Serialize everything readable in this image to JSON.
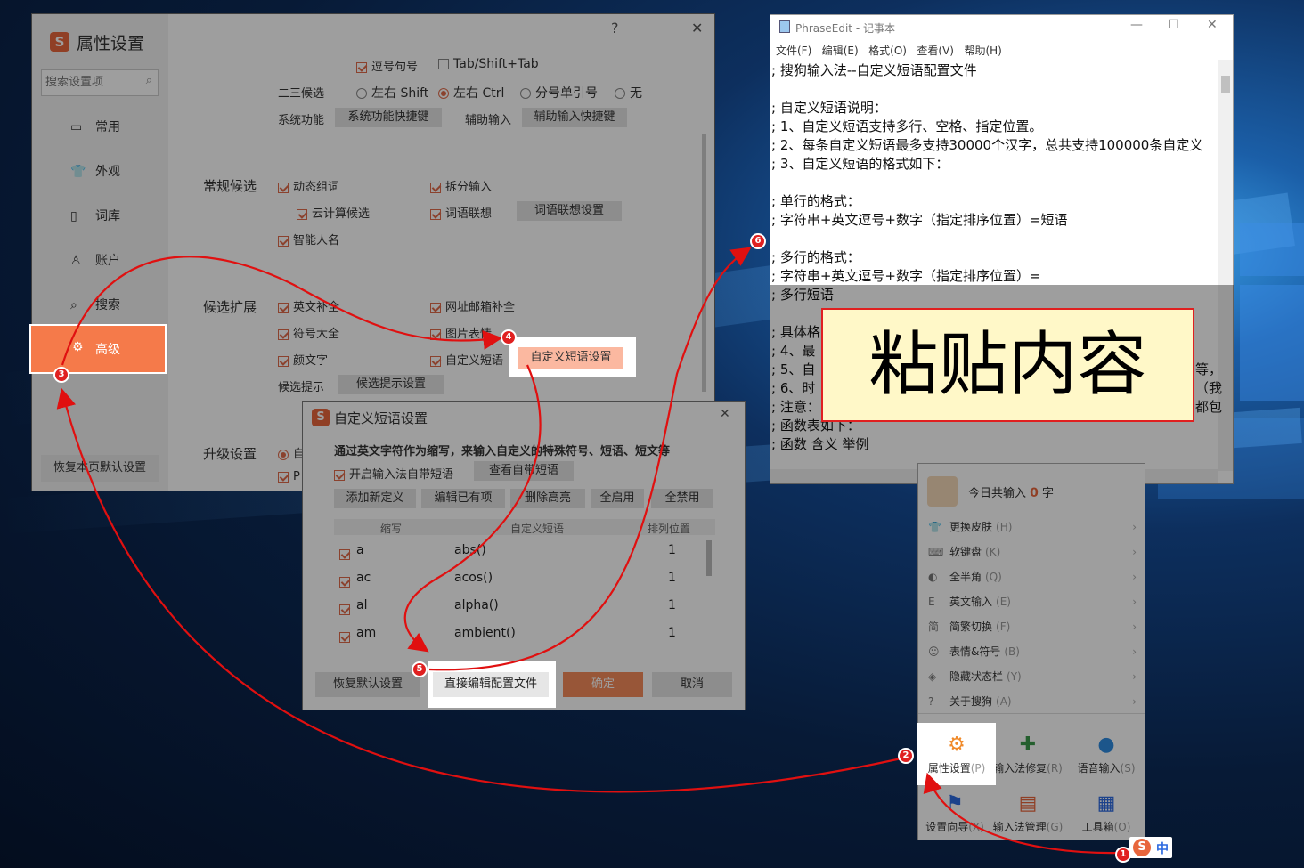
{
  "settings_window": {
    "title": "属性设置",
    "help_label": "?",
    "close_label": "✕",
    "search_placeholder": "搜索设置项",
    "nav": [
      {
        "label": "常用",
        "icon": "monitor-icon"
      },
      {
        "label": "外观",
        "icon": "shirt-icon"
      },
      {
        "label": "词库",
        "icon": "book-icon"
      },
      {
        "label": "账户",
        "icon": "person-icon"
      },
      {
        "label": "搜索",
        "icon": "search-icon"
      },
      {
        "label": "高级",
        "icon": "gear-icon"
      }
    ],
    "restore_default": "恢复本页默认设置",
    "row_top": {
      "comma_period": "逗号句号",
      "tab_shift": "Tab/Shift+Tab"
    },
    "second_third": {
      "label": "二三候选",
      "options": [
        "左右 Shift",
        "左右 Ctrl",
        "分号单引号",
        "无"
      ]
    },
    "system_func": {
      "label": "系统功能",
      "button": "系统功能快捷键",
      "aux_label": "辅助输入",
      "aux_button": "辅助输入快捷键"
    },
    "regular": {
      "label": "常规候选",
      "items": [
        "动态组词",
        "拆分输入",
        "云计算候选",
        "词语联想",
        "智能人名"
      ],
      "assoc_button": "词语联想设置"
    },
    "ext": {
      "label": "候选扩展",
      "items": [
        "英文补全",
        "网址邮箱补全",
        "符号大全",
        "图片表情",
        "颜文字",
        "自定义短语"
      ],
      "phrase_button": "自定义短语设置",
      "hint_label": "候选提示",
      "hint_button": "候选提示设置"
    },
    "upgrade": {
      "label": "升级设置",
      "opt1": "自",
      "opt2": "P"
    }
  },
  "phrase_dialog": {
    "title": "自定义短语设置",
    "close_label": "✕",
    "description": "通过英文字符作为缩写，来输入自定义的特殊符号、短语、短文等",
    "enable_label": "开启输入法自带短语",
    "view_button": "查看自带短语",
    "buttons": [
      "添加新定义",
      "编辑已有项",
      "删除高亮",
      "全启用",
      "全禁用"
    ],
    "columns": [
      "缩写",
      "自定义短语",
      "排列位置"
    ],
    "rows": [
      {
        "abbr": "a",
        "phrase": "abs()",
        "pos": "1"
      },
      {
        "abbr": "ac",
        "phrase": "acos()",
        "pos": "1"
      },
      {
        "abbr": "al",
        "phrase": "alpha()",
        "pos": "1"
      },
      {
        "abbr": "am",
        "phrase": "ambient()",
        "pos": "1"
      }
    ],
    "restore_button": "恢复默认设置",
    "edit_file_button": "直接编辑配置文件",
    "ok_button": "确定",
    "cancel_button": "取消"
  },
  "notepad": {
    "title": "PhraseEdit - 记事本",
    "menu": [
      "文件(F)",
      "编辑(E)",
      "格式(O)",
      "查看(V)",
      "帮助(H)"
    ],
    "lines": [
      ";  搜狗输入法--自定义短语配置文件",
      "",
      ";  自定义短语说明：",
      ";  1、自定义短语支持多行、空格、指定位置。",
      ";  2、每条自定义短语最多支持30000个汉字，总共支持100000条自定义",
      ";  3、自定义短语的格式如下：",
      "",
      ";  单行的格式：",
      ";  字符串+英文逗号+数字（指定排序位置）=短语",
      "",
      ";  多行的格式：",
      ";  字符串+英文逗号+数字（指定排序位置）=",
      ";  多行短语",
      "",
      ";  具体格",
      ";  4、最",
      ";  5、自",
      ";  6、时",
      ";  注意：",
      ";  函数表如下：",
      ";  函数         含义           举例"
    ],
    "right_clip": [
      "",
      "",
      "",
      "",
      "",
      "",
      "",
      "",
      "",
      "",
      "",
      "",
      "",
      "",
      "",
      "",
      "等，",
      "（我",
      "都包",
      "",
      ""
    ],
    "paste_label": "粘贴内容"
  },
  "ime_menu": {
    "today_prefix": "今日共输入",
    "today_count": "0",
    "today_suffix": "字",
    "items": [
      {
        "label": "更换皮肤",
        "key": "(H)",
        "icon": "shirt-icon"
      },
      {
        "label": "软键盘",
        "key": "(K)",
        "icon": "keyboard-icon"
      },
      {
        "label": "全半角",
        "key": "(Q)",
        "icon": "moon-icon"
      },
      {
        "label": "英文输入",
        "key": "(E)",
        "icon": "letter-e-icon"
      },
      {
        "label": "简繁切换",
        "key": "(F)",
        "icon": "simplified-icon"
      },
      {
        "label": "表情&符号",
        "key": "(B)",
        "icon": "smile-icon"
      },
      {
        "label": "隐藏状态栏",
        "key": "(Y)",
        "icon": "hide-icon"
      },
      {
        "label": "关于搜狗",
        "key": "(A)",
        "icon": "info-icon"
      }
    ],
    "tools": [
      {
        "label": "属性设置",
        "key": "(P)",
        "icon": "gear-icon"
      },
      {
        "label": "输入法修复",
        "key": "(R)",
        "icon": "repair-icon"
      },
      {
        "label": "语音输入",
        "key": "(S)",
        "icon": "mic-icon"
      },
      {
        "label": "设置向导",
        "key": "(X)",
        "icon": "flag-icon"
      },
      {
        "label": "输入法管理",
        "key": "(G)",
        "icon": "manage-icon"
      },
      {
        "label": "工具箱",
        "key": "(O)",
        "icon": "grid-icon"
      }
    ],
    "tray_mode": "中"
  },
  "steps": [
    "1",
    "2",
    "3",
    "4",
    "5",
    "6"
  ],
  "colors": {
    "accent": "#e8663c",
    "arrow": "#e01010",
    "paste_bg": "#fff8c8"
  }
}
